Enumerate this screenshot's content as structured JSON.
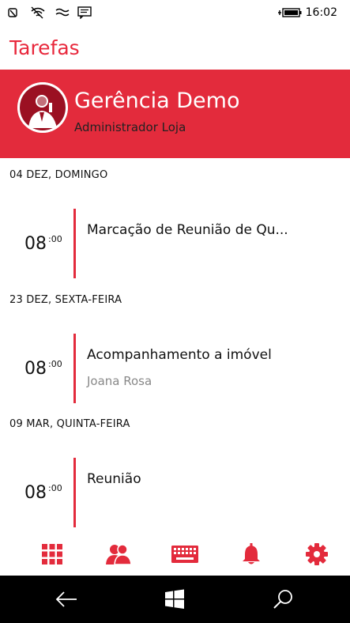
{
  "status_bar": {
    "time": "16:02",
    "icons": [
      "signal-icon",
      "wifi-icon",
      "connection-icon",
      "message-icon",
      "battery-icon"
    ]
  },
  "app": {
    "title": "Tarefas",
    "accent_color": "#e32b3c"
  },
  "profile": {
    "name": "Gerência Demo",
    "role": "Administrador Loja"
  },
  "agenda": {
    "days": [
      {
        "header": "04 DEZ, DOMINGO",
        "events": [
          {
            "hour": "08",
            "minutes": ":00",
            "title": "Marcação de Reunião de Qu...",
            "subtitle": ""
          }
        ]
      },
      {
        "header": "23 DEZ, SEXTA-FEIRA",
        "events": [
          {
            "hour": "08",
            "minutes": ":00",
            "title": "Acompanhamento a imóvel",
            "subtitle": "Joana Rosa"
          }
        ]
      },
      {
        "header": "09 MAR, QUINTA-FEIRA",
        "events": [
          {
            "hour": "08",
            "minutes": ":00",
            "title": "Reunião",
            "subtitle": ""
          }
        ]
      }
    ]
  },
  "app_bar": {
    "buttons": [
      "grid-icon",
      "people-icon",
      "keyboard-icon",
      "bell-icon",
      "gear-icon"
    ]
  },
  "nav_bar": {
    "buttons": [
      "back-arrow-icon",
      "windows-logo-icon",
      "search-icon"
    ]
  }
}
